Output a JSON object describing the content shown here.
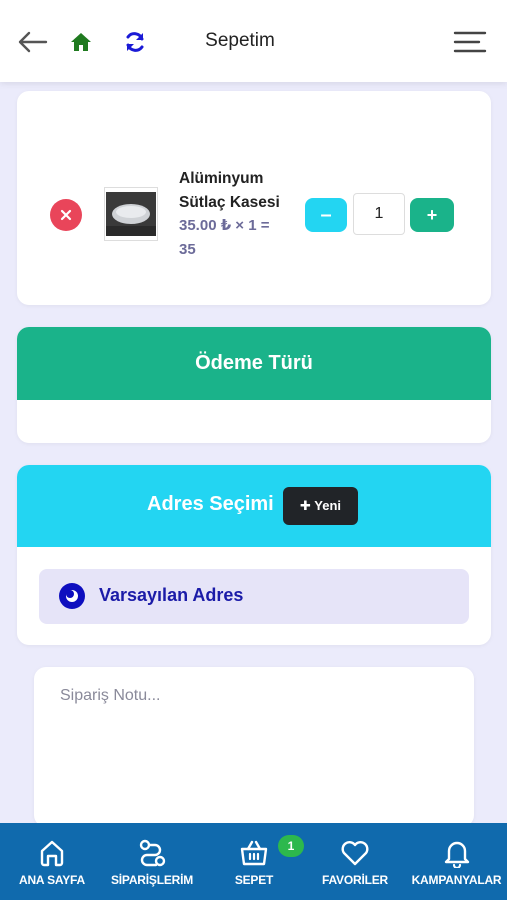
{
  "header": {
    "title": "Sepetim",
    "icons": {
      "back": "arrow-left-icon",
      "home": "home-icon",
      "refresh": "refresh-icon",
      "menu": "hamburger-menu-icon"
    },
    "colors": {
      "home": "#1f7a1f",
      "refresh": "#1a1ad6"
    }
  },
  "cart": {
    "items": [
      {
        "name": "Alüminyum Sütlaç Kasesi",
        "price_line": "35.00 ₺ × 1 = 35",
        "quantity": "1",
        "minus_label": "–",
        "plus_label": "+"
      }
    ]
  },
  "payment": {
    "title": "Ödeme Türü",
    "color": "#1ab38a"
  },
  "address": {
    "title": "Adres Seçimi",
    "new_button": "✚ Yeni",
    "options": [
      {
        "label": "Varsayılan Adres",
        "selected": true
      }
    ],
    "color": "#23d5f2"
  },
  "note": {
    "placeholder": "Sipariş Notu..."
  },
  "bottom_nav": {
    "items": [
      {
        "label": "ANA SAYFA",
        "icon": "home-outline-icon"
      },
      {
        "label": "SİPARİŞLERİM",
        "icon": "route-icon"
      },
      {
        "label": "SEPET",
        "icon": "basket-icon",
        "badge": "1"
      },
      {
        "label": "FAVORİLER",
        "icon": "heart-icon"
      },
      {
        "label": "KAMPANYALAR",
        "icon": "bell-icon"
      }
    ],
    "color": "#106aad"
  }
}
